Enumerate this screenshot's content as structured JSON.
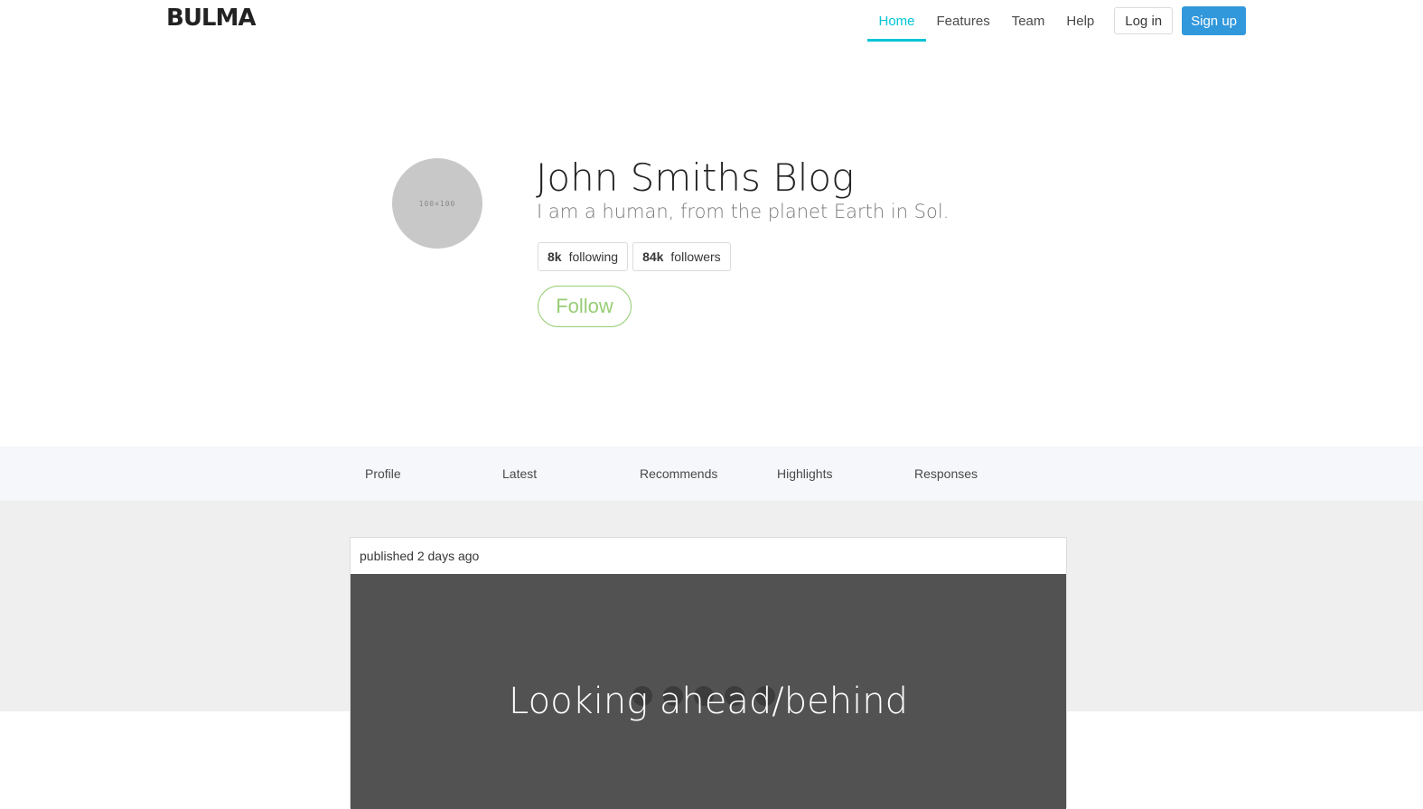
{
  "navbar": {
    "brand": "BULMA",
    "items": [
      {
        "label": "Home",
        "active": true
      },
      {
        "label": "Features",
        "active": false
      },
      {
        "label": "Team",
        "active": false
      },
      {
        "label": "Help",
        "active": false
      }
    ],
    "login_label": "Log in",
    "signup_label": "Sign up"
  },
  "profile": {
    "avatar_text": "100×100",
    "title": "John Smiths Blog",
    "subtitle": "I am a human, from the planet Earth in Sol.",
    "stats": [
      {
        "value": "8k",
        "label": "following"
      },
      {
        "value": "84k",
        "label": "followers"
      }
    ],
    "follow_label": "Follow"
  },
  "tabs": [
    "Profile",
    "Latest",
    "Recommends",
    "Highlights",
    "Responses"
  ],
  "post": {
    "published_label": "published 2 days ago",
    "image_title": "Looking ahead/behind"
  },
  "colors": {
    "accent": "#00c4d6",
    "signup": "#3298dc",
    "follow": "#97cd76",
    "tabs_bg": "#f5f7fa",
    "content_bg": "#efefef",
    "image_bg": "#525252"
  }
}
